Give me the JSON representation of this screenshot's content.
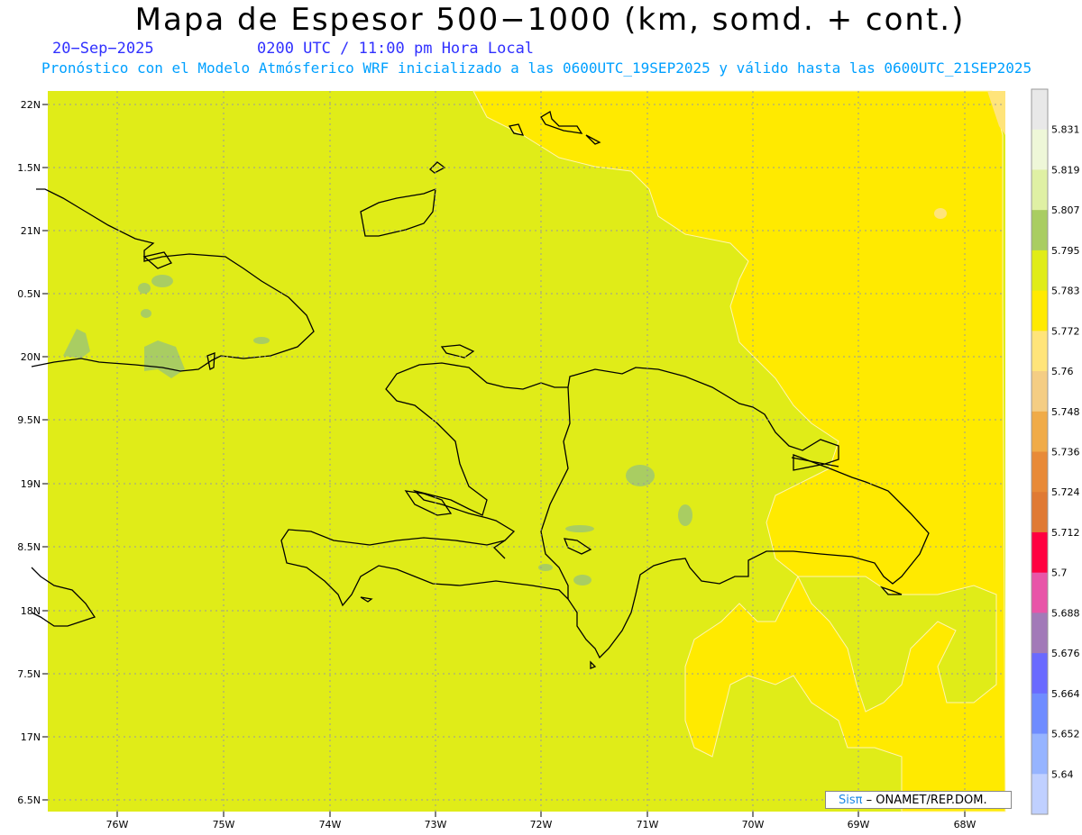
{
  "title": "Mapa de Espesor 500−1000 (km, somd. + cont.)",
  "date": "20−Sep−2025",
  "time_line": "0200 UTC / 11:00 pm Hora Local",
  "model_line": "Pronóstico con el Modelo Atmósferico WRF inicializado a las 0600UTC_19SEP2025 y válido hasta las  0600UTC_21SEP2025",
  "lat_labels": [
    "22N",
    "1.5N",
    "21N",
    "0.5N",
    "20N",
    "9.5N",
    "19N",
    "8.5N",
    "18N",
    "7.5N",
    "17N",
    "6.5N"
  ],
  "lon_labels": [
    "76W",
    "75W",
    "74W",
    "73W",
    "72W",
    "71W",
    "70W",
    "69W",
    "68W"
  ],
  "colorbar": {
    "labels": [
      "5.831",
      "5.819",
      "5.807",
      "5.795",
      "5.783",
      "5.772",
      "5.76",
      "5.748",
      "5.736",
      "5.724",
      "5.712",
      "5.7",
      "5.688",
      "5.676",
      "5.664",
      "5.652",
      "5.64"
    ],
    "colors": [
      "#e8e8e8",
      "#eef7d8",
      "#dff0a4",
      "#a9cd62",
      "#e0ec18",
      "#ffea00",
      "#ffe47a",
      "#f4cd84",
      "#f0ab48",
      "#e88a38",
      "#e07a34",
      "#ff0040",
      "#e855a8",
      "#a27ab8",
      "#6a6aff",
      "#6f8cff",
      "#96b4ff",
      "#c0d0ff"
    ]
  },
  "credit_logo": "Sisπ",
  "credit_text": "– ONAMET/REP.DOM."
}
